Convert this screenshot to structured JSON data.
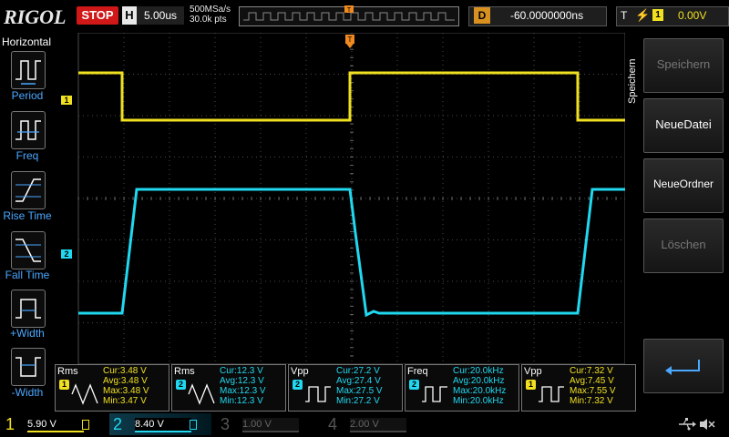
{
  "header": {
    "logo": "RIGOL",
    "run_state": "STOP",
    "trigger_mode": "H",
    "timebase": "5.00us",
    "sample_rate": "500MSa/s",
    "memory_depth": "30.0k pts",
    "delay_label": "D",
    "delay_value": "-60.0000000ns",
    "trigger_label": "T",
    "trigger_edge": "⚡",
    "trigger_source": "1",
    "trigger_level": "0.00V"
  },
  "left_menu": {
    "title": "Horizontal",
    "items": [
      {
        "label": "Period",
        "icon": "period-icon"
      },
      {
        "label": "Freq",
        "icon": "frequency-icon"
      },
      {
        "label": "Rise Time",
        "icon": "rise-time-icon"
      },
      {
        "label": "Fall Time",
        "icon": "fall-time-icon"
      },
      {
        "label": "+Width",
        "icon": "positive-width-icon"
      },
      {
        "label": "-Width",
        "icon": "negative-width-icon"
      }
    ]
  },
  "right_menu": {
    "title": "Speichern",
    "softkeys": [
      {
        "label": "Speichern",
        "enabled": false
      },
      {
        "label": "NeueDatei",
        "enabled": true
      },
      {
        "label": "NeueOrdner",
        "enabled": true
      },
      {
        "label": "Löschen",
        "enabled": false
      },
      {
        "label": "",
        "enabled": true,
        "icon": "return-arrow-icon"
      }
    ]
  },
  "channel_markers": {
    "ch1": "1",
    "ch2": "2"
  },
  "measurements": [
    {
      "name": "Rms",
      "channel": "1",
      "color": "#f0e020",
      "cur": "Cur:3.48 V",
      "avg": "Avg:3.48 V",
      "max": "Max:3.48 V",
      "min": "Min:3.47 V",
      "icon": "rms-icon"
    },
    {
      "name": "Rms",
      "channel": "2",
      "color": "#20d8f0",
      "cur": "Cur:12.3 V",
      "avg": "Avg:12.3 V",
      "max": "Max:12.3 V",
      "min": "Min:12.3 V",
      "icon": "rms-icon"
    },
    {
      "name": "Vpp",
      "channel": "2",
      "color": "#20d8f0",
      "cur": "Cur:27.2 V",
      "avg": "Avg:27.4 V",
      "max": "Max:27.5 V",
      "min": "Min:27.2 V",
      "icon": "vpp-icon"
    },
    {
      "name": "Freq",
      "channel": "2",
      "color": "#20d8f0",
      "cur": "Cur:20.0kHz",
      "avg": "Avg:20.0kHz",
      "max": "Max:20.0kHz",
      "min": "Min:20.0kHz",
      "icon": "frequency-icon"
    },
    {
      "name": "Vpp",
      "channel": "1",
      "color": "#f0e020",
      "cur": "Cur:7.32 V",
      "avg": "Avg:7.45 V",
      "max": "Max:7.55 V",
      "min": "Min:7.32 V",
      "icon": "vpp-icon"
    }
  ],
  "channels": [
    {
      "num": "1",
      "scale": "5.90 V",
      "color": "#f0e020",
      "active": true
    },
    {
      "num": "2",
      "scale": "8.40 V",
      "color": "#20d8f0",
      "active": true
    },
    {
      "num": "3",
      "scale": "1.00 V",
      "color": "#e040a0",
      "active": false
    },
    {
      "num": "4",
      "scale": "2.00 V",
      "color": "#4060ff",
      "active": false
    }
  ],
  "status": {
    "usb_icon": "usb-icon",
    "sound_icon": "speaker-muted-icon"
  },
  "colors": {
    "ch1": "#f0e020",
    "ch2": "#20d8f0",
    "accent": "#4aa8ff",
    "stop": "#d01818"
  }
}
